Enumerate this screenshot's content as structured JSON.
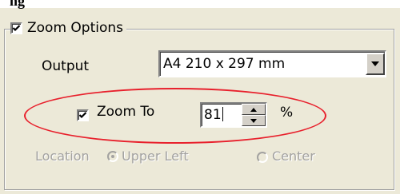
{
  "header": {
    "partial_text": "ng"
  },
  "zoom_options": {
    "checked": true,
    "label": "Zoom Options",
    "output": {
      "label": "Output",
      "selected": "A4 210 x 297 mm"
    },
    "zoom_to": {
      "checked": true,
      "label": "Zoom To",
      "value": "81",
      "unit": "%"
    },
    "location": {
      "label": "Location",
      "options": [
        {
          "label": "Upper Left",
          "selected": true
        },
        {
          "label": "Center",
          "selected": false
        }
      ]
    }
  },
  "colors": {
    "dialog_bg": "#ece9d8",
    "annotation_ellipse": "#e8202c",
    "disabled_text": "#a3a2a0"
  },
  "icons": [
    "checkmark-icon",
    "dropdown-arrow-icon",
    "spin-up-icon",
    "spin-down-icon",
    "radio-icon"
  ]
}
